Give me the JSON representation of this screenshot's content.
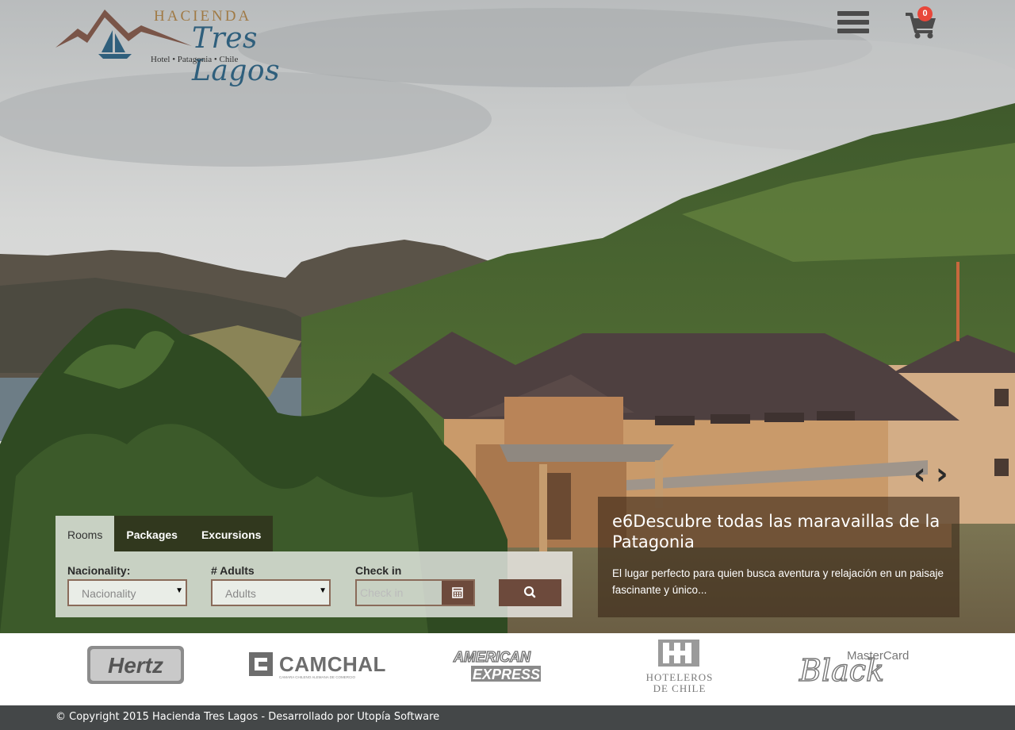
{
  "brand": {
    "name_line1": "HACIENDA",
    "name_line2": "Tres Lagos",
    "tagline": "Hotel • Patagonia • Chile"
  },
  "header": {
    "menu_icon": "hamburger-menu-icon",
    "cart_icon": "shopping-cart-icon",
    "cart_count": "0",
    "cart_badge_color": "#e8473a"
  },
  "slider": {
    "prev_icon": "chevron-left-icon",
    "next_icon": "chevron-right-icon",
    "prev_glyph": "‹",
    "next_glyph": "›",
    "title": "e6Descubre todas las maravaillas de la Patagonia",
    "text": "El lugar perfecto para quien busca aventura y relajación en un paisaje fascinante y único..."
  },
  "booking": {
    "tabs": [
      "Rooms",
      "Packages",
      "Excursions"
    ],
    "active_tab": "Rooms",
    "nationality": {
      "label": "Nacionality:",
      "value": "Nacionality"
    },
    "adults": {
      "label": "# Adults",
      "value": "Adults"
    },
    "checkin": {
      "label": "Check in",
      "placeholder": "Check in"
    },
    "calendar_icon": "calendar-icon",
    "search_icon": "search-icon",
    "accent_color": "#6d4a3c"
  },
  "partners": [
    "Hertz",
    "CAMCHAL",
    "AMERICAN EXPRESS",
    "Hoteleros de Chile",
    "MasterCard Black"
  ],
  "partner_text": {
    "camchal_sub": "CAMARA CHILENO ALEMANA DE COMERCIO",
    "amex_1": "AMERICAN",
    "amex_2": "EXPRESS",
    "hoteleros_1": "HOTELEROS",
    "hoteleros_2": "DE CHILE",
    "mastercard": "MasterCard",
    "black": "Black"
  },
  "footer": {
    "copyright": "© Copyright 2015 Hacienda Tres Lagos - Desarrollado por Utopía Software"
  }
}
